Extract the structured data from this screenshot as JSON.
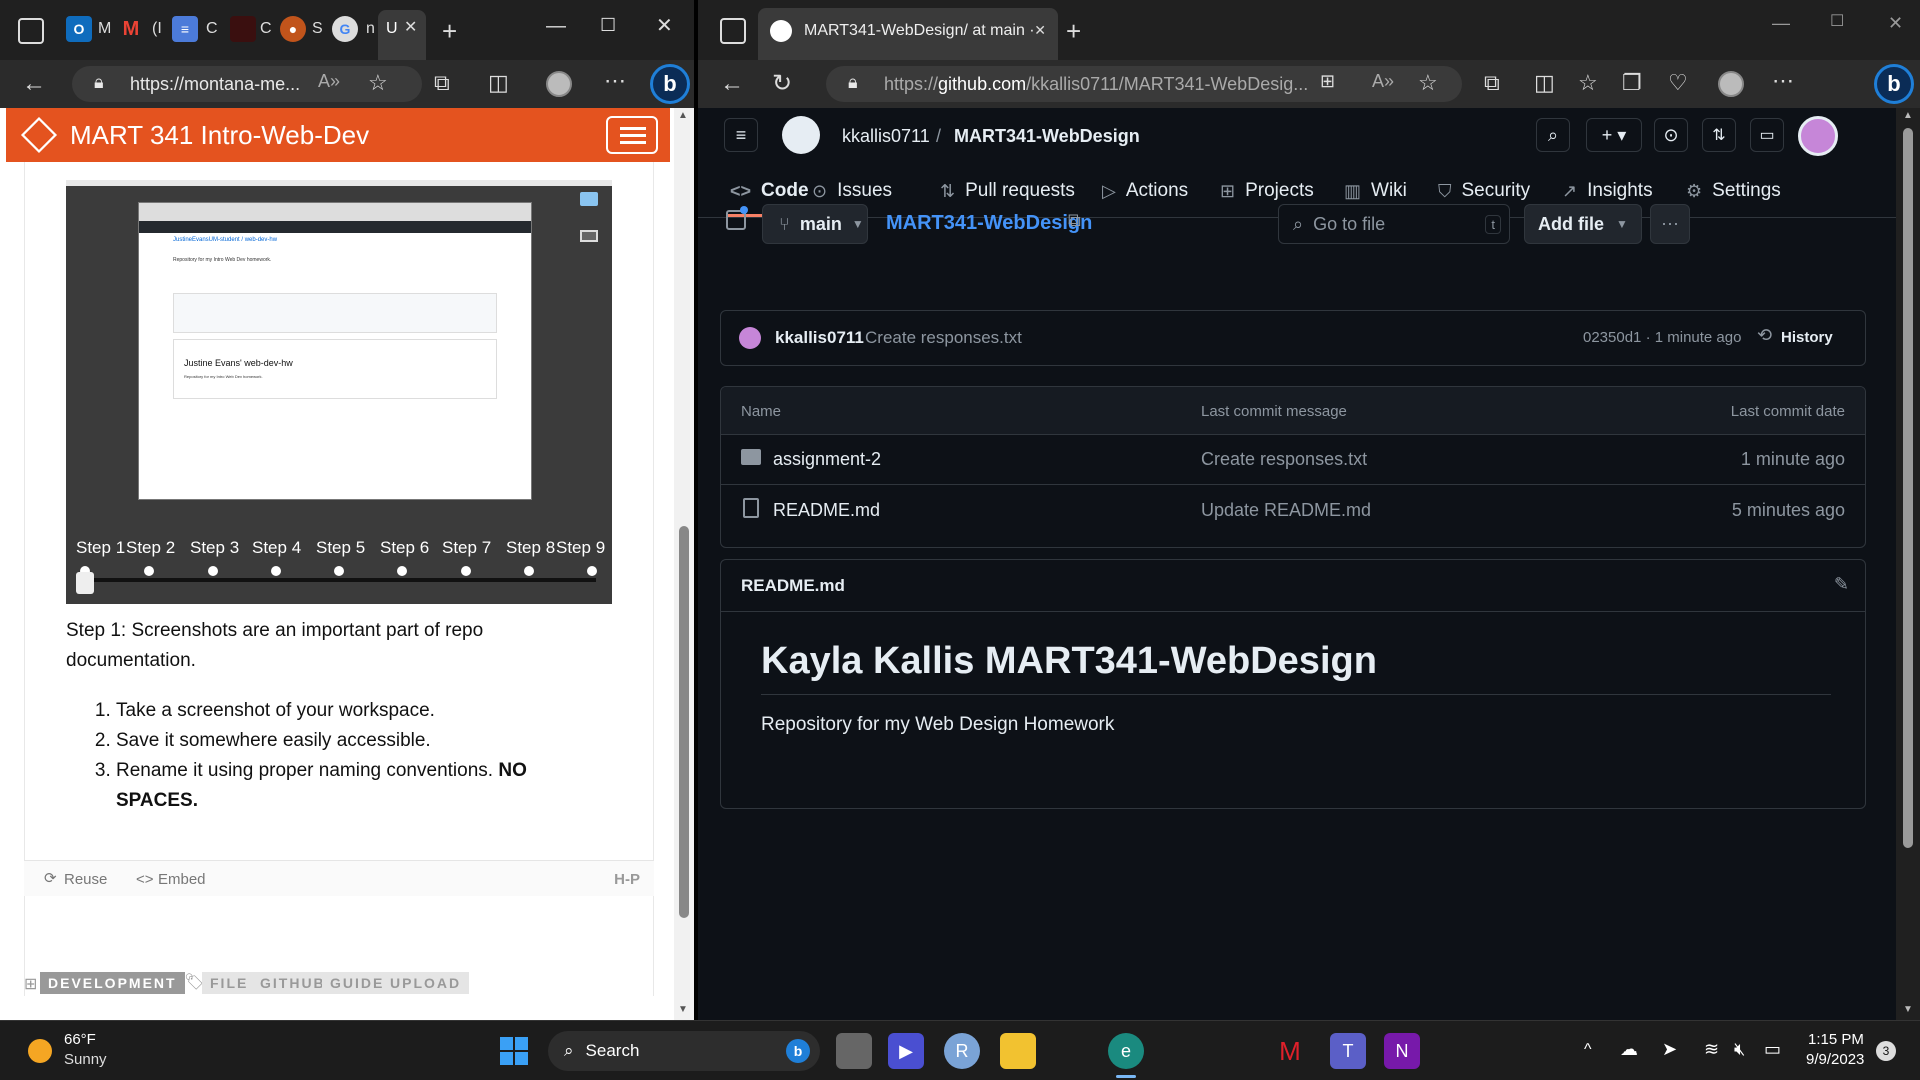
{
  "left_window": {
    "tabs": [
      {
        "letter": "M",
        "icon": "outlook-icon"
      },
      {
        "letter": "(I",
        "icon": "gmail-icon"
      },
      {
        "letter": "C",
        "icon": "docs-icon"
      },
      {
        "letter": "C",
        "icon": "blank-icon"
      },
      {
        "letter": "S",
        "icon": "firefox-icon"
      },
      {
        "letter": "n",
        "icon": "chrome-icon"
      },
      {
        "letter": "U",
        "icon": "active-tab"
      }
    ],
    "url": "https://montana-me...",
    "site_title": "MART 341 Intro-Web-Dev",
    "steps": [
      "Step 1",
      "Step 2",
      "Step 3",
      "Step 4",
      "Step 5",
      "Step 6",
      "Step 7",
      "Step 8",
      "Step 9"
    ],
    "slide_inner": {
      "repo_path": "JustineEvansUM-student / web-dev-hw",
      "description": "Repository for my Intro Web Dev homework.",
      "readme_title": "Justine Evans' web-dev-hw",
      "readme_body": "Repository for my Intro Web Dev homework."
    },
    "step_text": "Step 1: Screenshots are an important part of repo documentation.",
    "step_list": [
      "Take a screenshot of your workspace.",
      "Save it somewhere easily accessible.",
      "Rename it using proper naming conventions. "
    ],
    "step_list_bold": "NO SPACES.",
    "reuse_label": "Reuse",
    "embed_label": "Embed",
    "h5p_label": "H-P",
    "category_tag": "DEVELOPMENT",
    "tags": [
      "FILE",
      "GITHUB",
      "GUIDE",
      "UPLOAD"
    ]
  },
  "right_window": {
    "tab_title": "MART341-WebDesign/ at main ·",
    "url_prefix": "https://",
    "url_host": "github.com",
    "url_path": "/kkallis0711/MART341-WebDesig...",
    "owner": "kkallis0711",
    "separator": "/",
    "repo": "MART341-WebDesign",
    "nav": [
      {
        "label": "Code",
        "icon": "code-icon"
      },
      {
        "label": "Issues",
        "icon": "issue-icon"
      },
      {
        "label": "Pull requests",
        "icon": "pull-request-icon"
      },
      {
        "label": "Actions",
        "icon": "play-icon"
      },
      {
        "label": "Projects",
        "icon": "table-icon"
      },
      {
        "label": "Wiki",
        "icon": "book-icon"
      },
      {
        "label": "Security",
        "icon": "shield-icon"
      },
      {
        "label": "Insights",
        "icon": "graph-icon"
      },
      {
        "label": "Settings",
        "icon": "gear-icon"
      }
    ],
    "branch": "main",
    "repo_breadcrumb": "MART341-WebDesign",
    "goto_placeholder": "Go to file",
    "goto_shortcut": "t",
    "add_file_label": "Add file",
    "commit": {
      "author": "kkallis0711",
      "message": "Create responses.txt",
      "hash_time": "02350d1 · 1 minute ago",
      "history_label": "History"
    },
    "table_headers": {
      "name": "Name",
      "message": "Last commit message",
      "date": "Last commit date"
    },
    "files": [
      {
        "name": "assignment-2",
        "type": "folder",
        "message": "Create responses.txt",
        "date": "1 minute ago"
      },
      {
        "name": "README.md",
        "type": "file",
        "message": "Update README.md",
        "date": "5 minutes ago"
      }
    ],
    "readme_label": "README.md",
    "readme_title": "Kayla Kallis MART341-WebDesign",
    "readme_body": "Repository for my Web Design Homework"
  },
  "taskbar": {
    "temp": "66°F",
    "condition": "Sunny",
    "search_label": "Search",
    "time": "1:15 PM",
    "date": "9/9/2023",
    "notifications": "3"
  },
  "colors": {
    "site_orange": "#e4531f",
    "gh_bg": "#0d1117",
    "gh_link": "#4493f8",
    "gh_accent_underline": "#f78166"
  }
}
